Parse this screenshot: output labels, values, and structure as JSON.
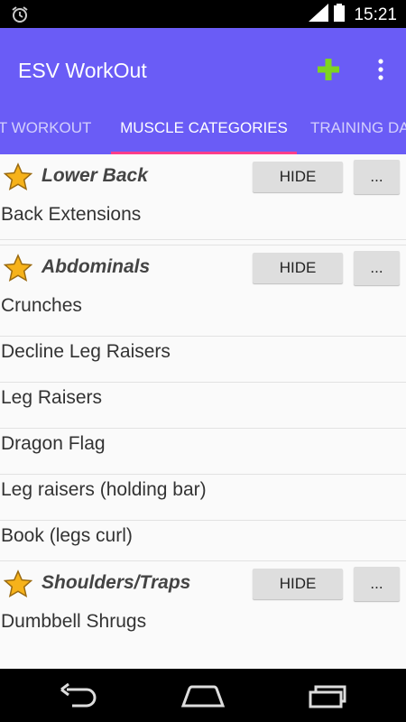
{
  "status_bar": {
    "time": "15:21",
    "icons": [
      "alarm-icon",
      "signal-icon",
      "battery-icon"
    ]
  },
  "app_bar": {
    "title": "ESV WorkOut",
    "background": "#6a5cf6",
    "add_icon_color": "#7ed321"
  },
  "tabs": [
    {
      "label": "ST WORKOUT"
    },
    {
      "label": "MUSCLE CATEGORIES",
      "selected": true
    },
    {
      "label": "TRAINING DA"
    }
  ],
  "accent_indicator": "#ff3d8a",
  "categories": [
    {
      "name": "Lower Back",
      "hide_label": "HIDE",
      "more_label": "...",
      "exercises": [
        "Back Extensions"
      ]
    },
    {
      "name": "Abdominals",
      "hide_label": "HIDE",
      "more_label": "...",
      "exercises": [
        "Crunches",
        "Decline Leg Raisers",
        "Leg Raisers",
        "Dragon Flag",
        "Leg raisers (holding bar)",
        "Book (legs curl)"
      ]
    },
    {
      "name": "Shoulders/Traps",
      "hide_label": "HIDE",
      "more_label": "...",
      "exercises": [
        "Dumbbell Shrugs"
      ]
    }
  ]
}
